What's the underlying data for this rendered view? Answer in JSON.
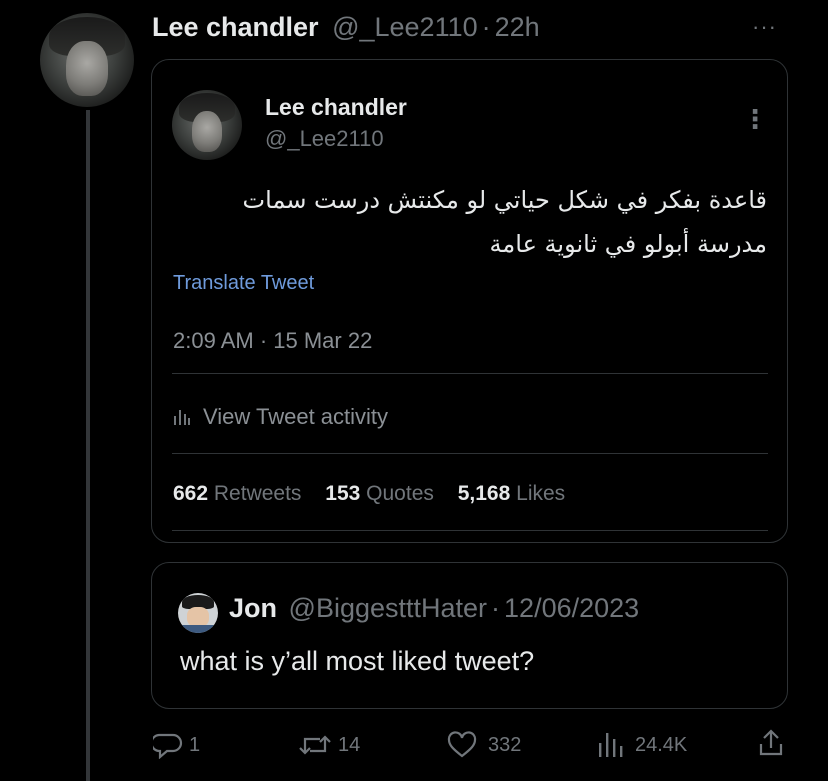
{
  "tweet": {
    "author_name": "Lee chandler",
    "author_handle": "@_Lee2110",
    "separator": "·",
    "time_ago": "22h",
    "more_label": "···"
  },
  "embedded": {
    "author_name": "Lee chandler",
    "author_handle": "@_Lee2110",
    "more_label": "⋮",
    "text_line1": "قاعدة بفكر في شكل حياتي لو مكنتش درست سمات",
    "text_line2": "مدرسة أبولو في ثانوية عامة",
    "translate_label": "Translate Tweet",
    "timestamp": "2:09 AM · 15 Mar 22",
    "activity_label": "View Tweet activity",
    "stats": {
      "retweets_count": "662",
      "retweets_label": "Retweets",
      "quotes_count": "153",
      "quotes_label": "Quotes",
      "likes_count": "5,168",
      "likes_label": "Likes"
    }
  },
  "quoted": {
    "author_name": "Jon",
    "author_handle": "@BiggestttHater",
    "separator": "·",
    "date": "12/06/2023",
    "text": "what is y’all most liked tweet?"
  },
  "actions": {
    "replies": "1",
    "retweets": "14",
    "likes": "332",
    "views": "24.4K"
  },
  "colors": {
    "background": "#000000",
    "link": "#1d9bf0",
    "muted": "#71767b",
    "border": "#2f3336"
  }
}
